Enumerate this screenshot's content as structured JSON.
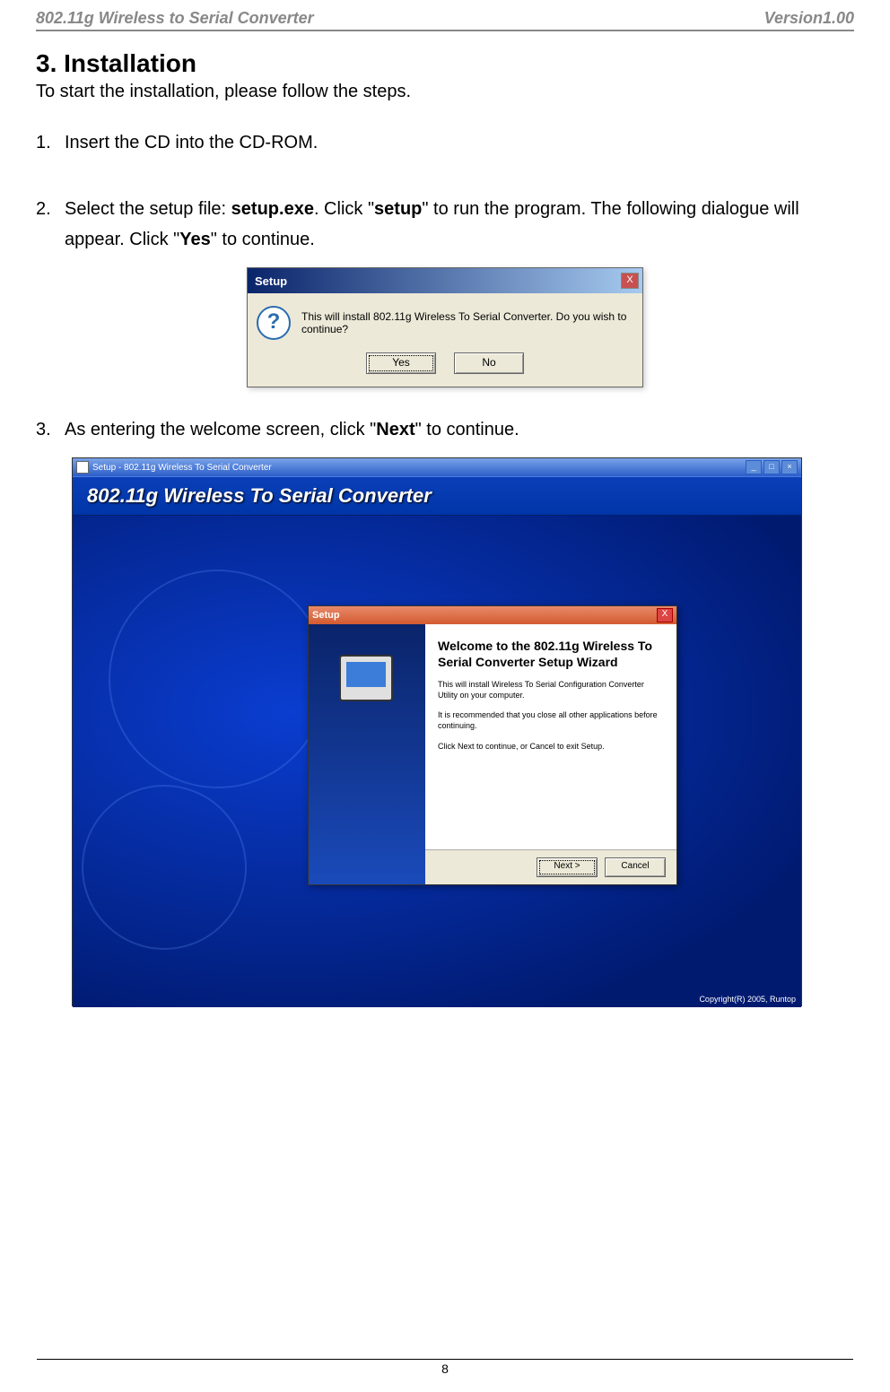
{
  "header": {
    "left": "802.11g Wireless to Serial Converter",
    "right": "Version1.00"
  },
  "section_title": "3. Installation",
  "intro": "To start the installation, please follow the steps.",
  "steps": {
    "s1": {
      "num": "1.",
      "text": "Insert the CD into the CD-ROM."
    },
    "s2": {
      "num": "2.",
      "pre": "Select the setup file: ",
      "bold1": "setup.exe",
      "mid1": ". Click \"",
      "bold2": "setup",
      "mid2": "\" to run the program. The following dialogue will appear. Click \"",
      "bold3": "Yes",
      "post": "\" to continue."
    },
    "s3": {
      "num": "3.",
      "pre": "As entering the welcome screen, click \"",
      "bold1": "Next",
      "post": "\" to continue."
    }
  },
  "dialog1": {
    "title": "Setup",
    "close": "X",
    "message": "This will install 802.11g Wireless To Serial Converter. Do you wish to continue?",
    "yes": "Yes",
    "no": "No"
  },
  "installer": {
    "title": "Setup - 802.11g Wireless To Serial Converter",
    "banner": "802.11g Wireless To Serial Converter",
    "copyright": "Copyright(R) 2005, Runtop"
  },
  "wizard": {
    "title": "Setup",
    "close": "X",
    "heading": "Welcome to the 802.11g Wireless To Serial Converter Setup Wizard",
    "p1": "This will install Wireless To Serial Configuration Converter Utility on your computer.",
    "p2": "It is recommended that you close all other applications before continuing.",
    "p3": "Click Next to continue, or Cancel to exit Setup.",
    "next": "Next >",
    "cancel": "Cancel"
  },
  "page_number": "8"
}
